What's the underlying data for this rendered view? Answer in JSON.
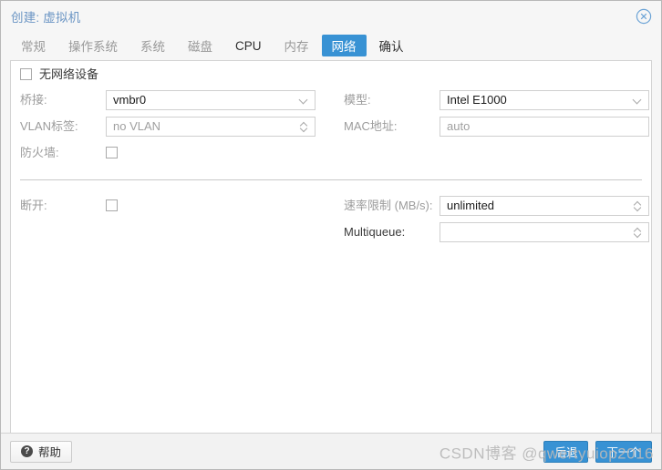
{
  "window": {
    "title": "创建: 虚拟机",
    "close_icon": "close-circle-icon"
  },
  "tabs": [
    {
      "label": "常规",
      "active": false,
      "dark": false
    },
    {
      "label": "操作系统",
      "active": false,
      "dark": false
    },
    {
      "label": "系统",
      "active": false,
      "dark": false
    },
    {
      "label": "磁盘",
      "active": false,
      "dark": false
    },
    {
      "label": "CPU",
      "active": false,
      "dark": true
    },
    {
      "label": "内存",
      "active": false,
      "dark": false
    },
    {
      "label": "网络",
      "active": true,
      "dark": false
    },
    {
      "label": "确认",
      "active": false,
      "dark": true
    }
  ],
  "form": {
    "no_network_device": {
      "label": "无网络设备",
      "checked": false
    },
    "bridge": {
      "label": "桥接:",
      "value": "vmbr0",
      "is_placeholder": false,
      "trigger": "chevron-down-icon"
    },
    "vlan_tag": {
      "label": "VLAN标签:",
      "value": "no VLAN",
      "is_placeholder": true,
      "trigger": "spinner-icon"
    },
    "firewall": {
      "label": "防火墙:",
      "checked": false
    },
    "model": {
      "label": "模型:",
      "value": "Intel E1000",
      "is_placeholder": false,
      "trigger": "chevron-down-icon"
    },
    "mac_address": {
      "label": "MAC地址:",
      "value": "auto",
      "is_placeholder": true,
      "trigger": "none"
    },
    "disconnect": {
      "label": "断开:",
      "checked": false
    },
    "rate_limit": {
      "label": "速率限制 (MB/s):",
      "value": "unlimited",
      "is_placeholder": false,
      "trigger": "spinner-icon"
    },
    "multiqueue": {
      "label": "Multiqueue:",
      "value": "",
      "is_placeholder": true,
      "trigger": "spinner-icon"
    }
  },
  "footer": {
    "help_label": "帮助",
    "help_icon": "question-mark-icon",
    "back_label": "后退",
    "next_label": "下一个"
  },
  "watermark": {
    "text": "CSDN博客 @qwertyuiop2016"
  },
  "colors": {
    "accent": "#3892d4",
    "title": "#6b95c4",
    "label": "#9c9c9c",
    "label_dark": "#3a3a3a",
    "field_border": "#cfcfcf",
    "panel_bg": "#ffffff",
    "chrome_bg": "#f6f6f6",
    "footer_bg": "#f2f2f2"
  }
}
